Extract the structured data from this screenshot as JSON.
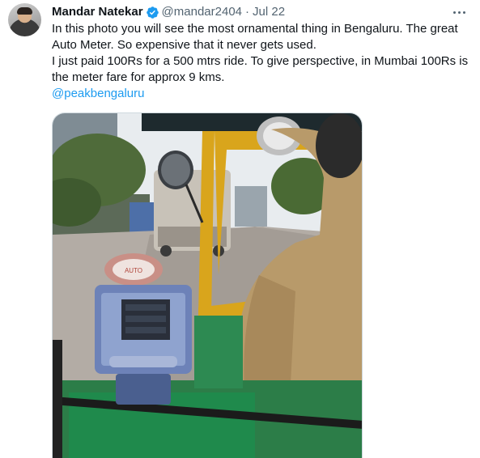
{
  "tweet": {
    "author": {
      "display_name": "Mandar Natekar",
      "handle": "@mandar2404",
      "verified": true
    },
    "date_separator": "·",
    "date": "Jul 22",
    "text_lines": [
      "In this photo you will see the most ornamental thing in Bengaluru. The great Auto Meter. So expensive that it never gets used.",
      "I just paid 100Rs for a 500 mtrs ride. To give perspective, in Mumbai 100Rs is the meter fare for approx 9 kms."
    ],
    "mention": "@peakbengaluru",
    "media": {
      "description_icon": "photo",
      "meter_label": "AUTO"
    }
  },
  "colors": {
    "text": "#0f1419",
    "secondary": "#536471",
    "link": "#1d9bf0",
    "verified": "#1d9bf0",
    "border": "#cfd9de",
    "auto_yellow": "#d9a51c",
    "auto_green": "#1f8a4c",
    "meter_blue": "#6d82b8"
  },
  "icons": {
    "verified": "verified-badge-icon",
    "more": "more-options-icon"
  }
}
